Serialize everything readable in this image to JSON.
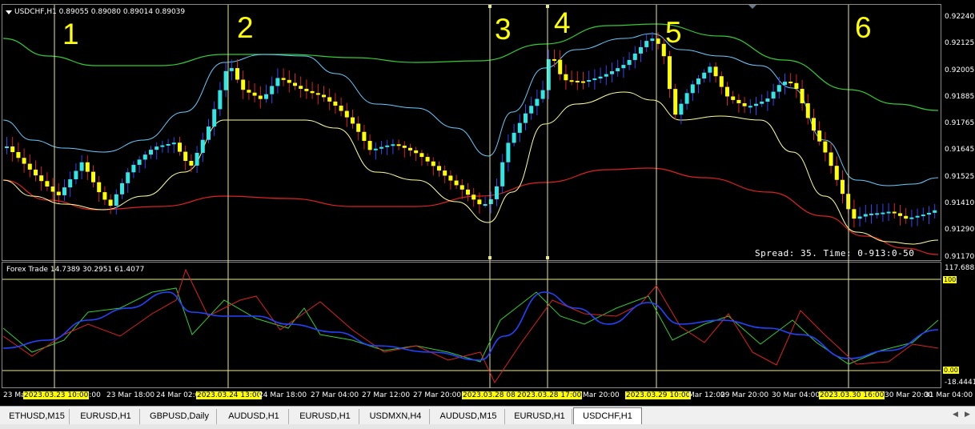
{
  "chart": {
    "title": "USDCHF,H1  0.89055 0.89080 0.89014 0.89039",
    "spread_text": "Spread: 35. Time: 0-913:0-50",
    "numbers": [
      "1",
      "2",
      "3",
      "4",
      "5",
      "6"
    ],
    "price_axis": [
      "0.92240",
      "0.92125",
      "0.92005",
      "0.91885",
      "0.91765",
      "0.91645",
      "0.91525",
      "0.91410",
      "0.91290",
      "0.91170"
    ],
    "time_axis": [
      "23 Mar",
      "2023.03.23 10:00",
      "23 Mar 18:00",
      "24 Mar 02:00",
      "2023.03.24 13:00",
      "24 Mar 18:00",
      "27 Mar 04:00",
      "27 Mar 12:00",
      "27 Mar 20:00",
      "2023.03.28 08:00",
      "2023.03.28 17:00",
      "Mar 20:00",
      "2023.03.29 10:00",
      "Mar 12:00",
      "29 Mar 20:00",
      "30 Mar 04:00",
      "2023.03.30 16:00",
      "30 Mar 20:00",
      "31 Mar 04:00"
    ]
  },
  "indicator": {
    "title": "Forex Trade 14.7389 30.2951 61.4077",
    "axis_top": "117.6881",
    "axis_bottom": "-18.4441",
    "level_100": "100",
    "level_0": "0.00"
  },
  "tabs": [
    "ETHUSD,M15",
    "EURUSD,H1",
    "GBPUSD,Daily",
    "AUDUSD,H1",
    "EURUSD,H1",
    "USDMXN,H4",
    "AUDUSD,M15",
    "EURUSD,H1",
    "USDCHF,H1"
  ],
  "active_tab": "USDCHF,H1",
  "colors": {
    "bull": "#33e6e6",
    "bear": "#ffff00",
    "band_upper": "#66ccff",
    "band_lower": "#ffff99",
    "ma_green": "#33cc33",
    "ma_red": "#dd2222",
    "osc_blue": "#2244ff",
    "osc_green": "#33cc33",
    "osc_red": "#dd2222"
  }
}
